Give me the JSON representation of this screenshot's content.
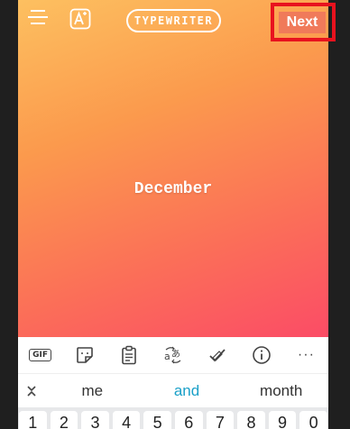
{
  "header": {
    "style_label": "TYPEWRITER",
    "next_label": "Next"
  },
  "canvas": {
    "story_text": "December"
  },
  "toolbar": {
    "gif_label": "GIF",
    "more_label": "···"
  },
  "suggestions": [
    "me",
    "and",
    "month"
  ],
  "number_keys": [
    "1",
    "2",
    "3",
    "4",
    "5",
    "6",
    "7",
    "8",
    "9",
    "0"
  ],
  "colors": {
    "gradient_top": "#fdc060",
    "gradient_bottom": "#fb4c66",
    "highlight": "#e8121e",
    "suggestion_accent": "#1aa0c8"
  }
}
